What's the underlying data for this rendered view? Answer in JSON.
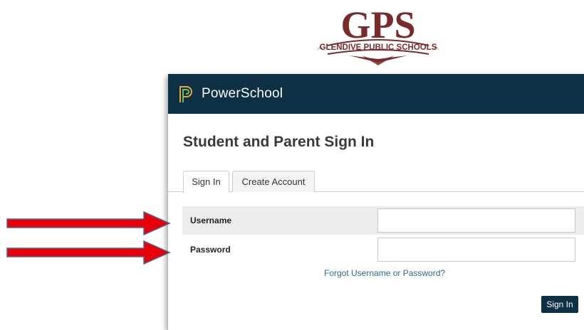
{
  "logo": {
    "initials": "GPS",
    "district_name": "GLENDIVE PUBLIC SCHOOLS"
  },
  "header": {
    "brand": "PowerSchool",
    "brand_icon": "powerschool-p-icon"
  },
  "page": {
    "title": "Student and Parent Sign In"
  },
  "tabs": [
    {
      "label": "Sign In",
      "active": true
    },
    {
      "label": "Create Account",
      "active": false
    }
  ],
  "form": {
    "username_label": "Username",
    "username_value": "",
    "password_label": "Password",
    "password_value": "",
    "forgot_link": "Forgot Username or Password?",
    "submit_label": "Sign In"
  },
  "annotations": {
    "arrow_icon": "red-arrow-icon",
    "arrow_color": "#e8000a"
  },
  "colors": {
    "header_bg": "#0d3045",
    "logo_maroon": "#7a2a2b",
    "link": "#2a6a93",
    "row_highlight": "#ececec"
  }
}
